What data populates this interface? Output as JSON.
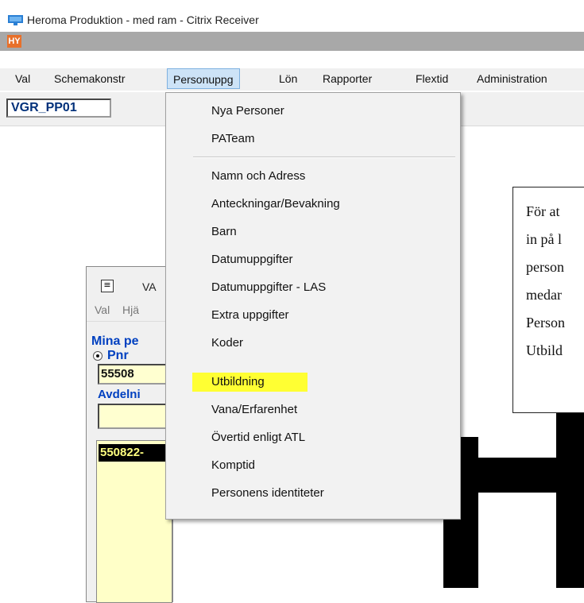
{
  "window": {
    "title": "Heroma Produktion - med ram - Citrix Receiver",
    "icon": "monitor-icon"
  },
  "app": {
    "logo_text": "HY"
  },
  "menubar": {
    "items": [
      "Val",
      "Schemakonstr",
      "Personuppg",
      "Lön",
      "Rapporter",
      "Flextid",
      "Administration"
    ]
  },
  "toolbar": {
    "combo_value": "VGR_PP01"
  },
  "dropdown": {
    "items": [
      "Nya Personer",
      "PATeam",
      "Namn och Adress",
      "Anteckningar/Bevakning",
      "Barn",
      "Datumuppgifter",
      "Datumuppgifter - LAS",
      "Extra uppgifter",
      "Koder",
      "Utbildning",
      "Vana/Erfarenhet",
      "Övertid enligt ATL",
      "Komptid",
      "Personens identiteter"
    ],
    "highlighted": "Utbildning",
    "highlight_color": "#ffff33"
  },
  "child_window": {
    "title": "VA",
    "menu": [
      "Val",
      "Hjä"
    ],
    "heading": "Mina pe",
    "radio_label": "Pnr",
    "pnr_value": "55508",
    "avd_label": "Avdelni",
    "list_selected": "550822-"
  },
  "callout": {
    "lines": [
      "För at",
      "in på l",
      "person",
      "medar",
      "Person",
      "Utbild"
    ]
  }
}
